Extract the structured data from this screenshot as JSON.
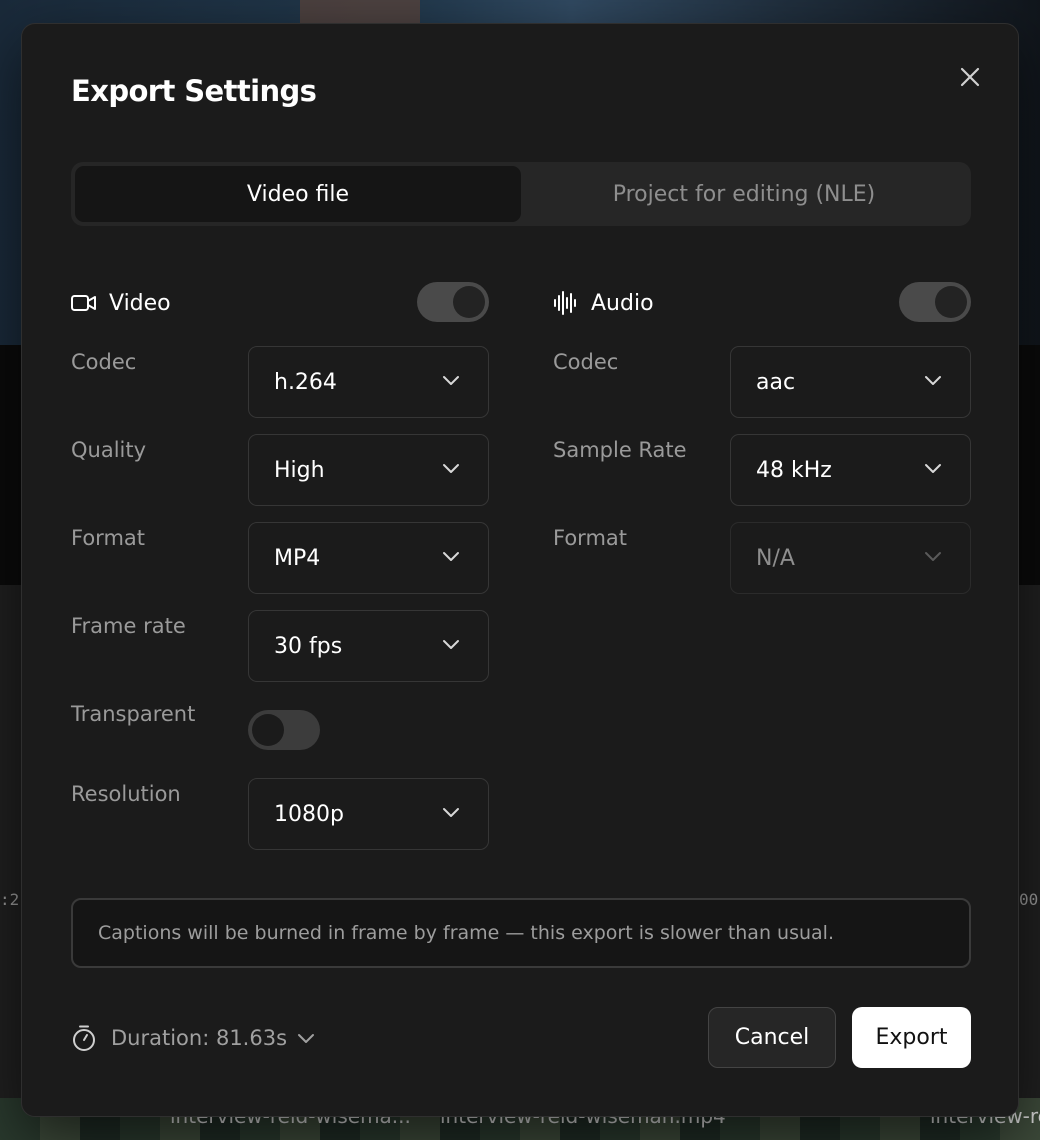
{
  "dialog": {
    "title": "Export Settings",
    "tabs": [
      {
        "label": "Video file",
        "active": true
      },
      {
        "label": "Project for editing (NLE)",
        "active": false
      }
    ]
  },
  "video": {
    "section_label": "Video",
    "enabled": true,
    "rows": [
      {
        "label": "Codec",
        "value": "h.264"
      },
      {
        "label": "Quality",
        "value": "High"
      },
      {
        "label": "Format",
        "value": "MP4"
      },
      {
        "label": "Frame rate",
        "value": "30 fps"
      },
      {
        "label": "Transparent",
        "toggle": false
      },
      {
        "label": "Resolution",
        "value": "1080p"
      }
    ]
  },
  "audio": {
    "section_label": "Audio",
    "enabled": true,
    "rows": [
      {
        "label": "Codec",
        "value": "aac"
      },
      {
        "label": "Sample Rate",
        "value": "48 kHz"
      },
      {
        "label": "Format",
        "value": "N/A",
        "disabled": true
      }
    ]
  },
  "notice": "Captions will be burned in frame by frame — this export is slower than usual.",
  "footer": {
    "duration": "Duration: 81.63s",
    "cancel_label": "Cancel",
    "export_label": "Export"
  },
  "background": {
    "timecode_left": ":2",
    "timecode_right": "00",
    "clips": [
      "interview-reid-wisema...",
      "interview-reid-wiseman.mp4",
      "interview-re"
    ]
  },
  "colors": {
    "modal_bg": "#1b1b1b",
    "primary_button": "#ffffff",
    "toggle_on": "#4a4a4a"
  }
}
